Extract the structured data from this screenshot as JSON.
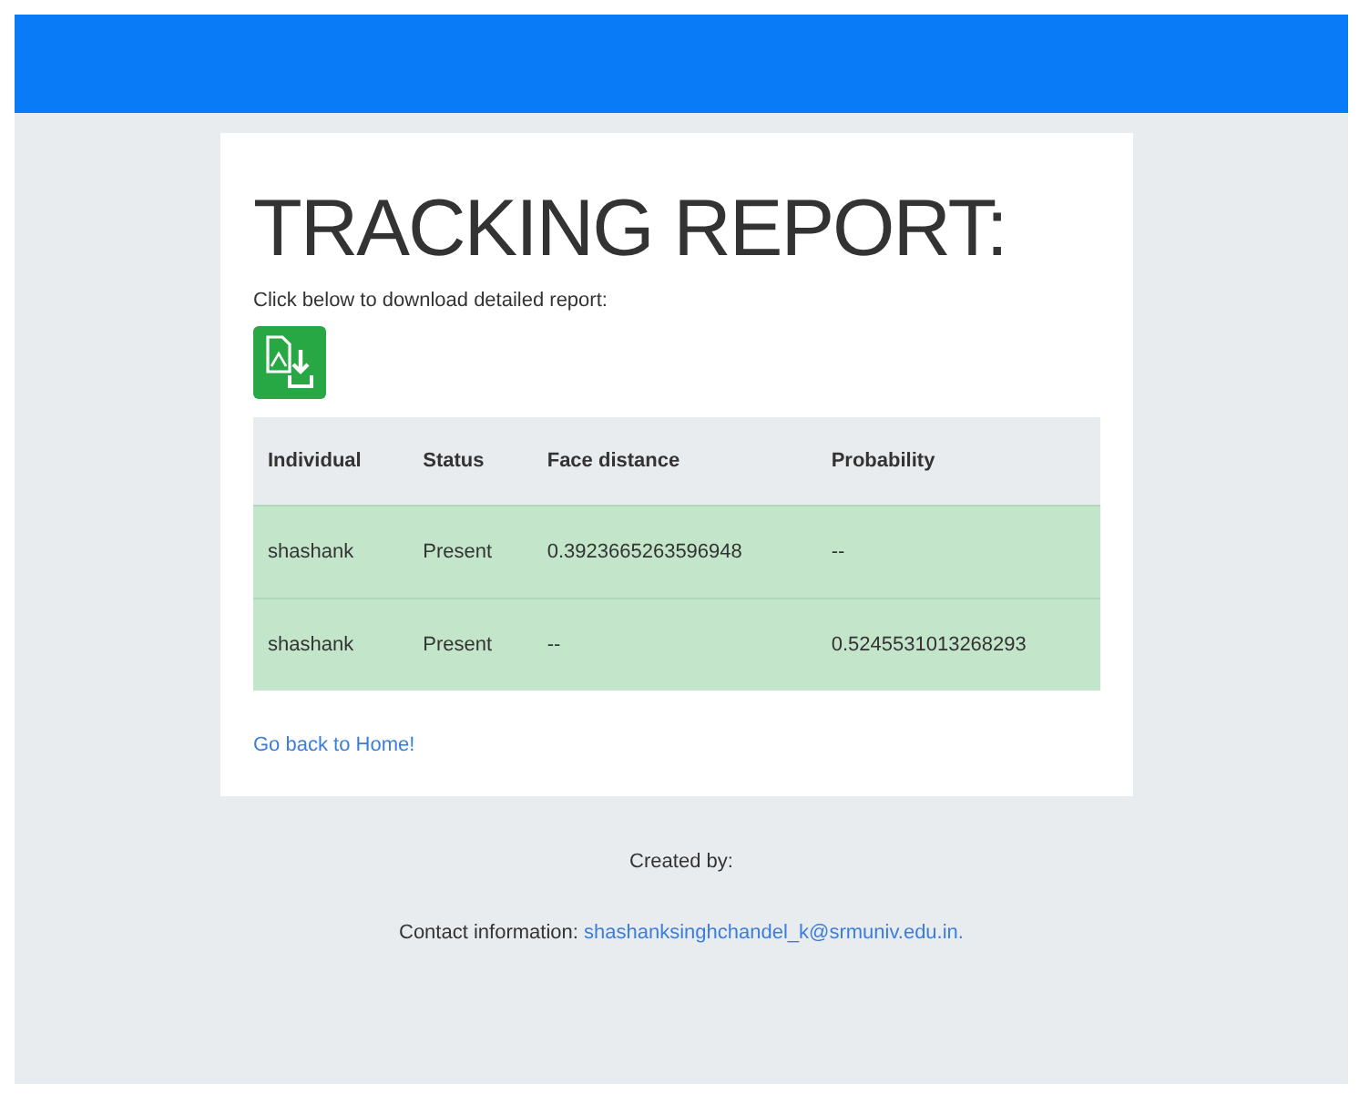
{
  "title": "TRACKING REPORT:",
  "download_prompt": "Click below to download detailed report:",
  "table": {
    "columns": [
      "Individual",
      "Status",
      "Face distance",
      "Probability"
    ],
    "rows": [
      [
        "shashank",
        "Present",
        "0.3923665263596948",
        "--"
      ],
      [
        "shashank",
        "Present",
        "--",
        "0.5245531013268293"
      ]
    ]
  },
  "home_link": "Go back to Home!",
  "footer": {
    "created_by": "Created by:",
    "contact_label": "Contact information:",
    "contact_email": "shashanksinghchandel_k@srmuniv.edu.in."
  }
}
